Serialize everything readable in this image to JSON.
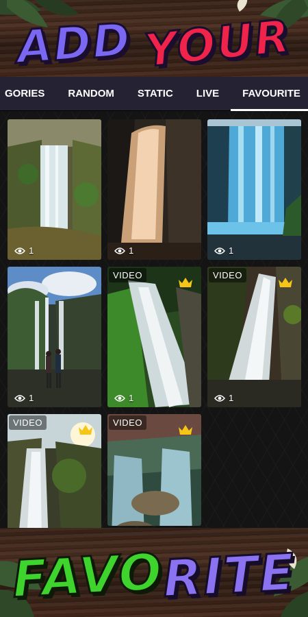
{
  "banner_top": {
    "word1": "ADD",
    "word2": "YOUR"
  },
  "banner_bottom": {
    "part_green": "FAVO",
    "part_purple": "RITE"
  },
  "tabs": [
    {
      "label": "GORIES",
      "active": false
    },
    {
      "label": "RANDOM",
      "active": false
    },
    {
      "label": "STATIC",
      "active": false
    },
    {
      "label": "LIVE",
      "active": false
    },
    {
      "label": "FAVOURITE",
      "active": true
    }
  ],
  "wallpapers": [
    {
      "type": "static",
      "views": "1",
      "premium": false
    },
    {
      "type": "static",
      "views": "1",
      "premium": false
    },
    {
      "type": "static",
      "views": "1",
      "premium": false
    },
    {
      "type": "static",
      "views": "1",
      "premium": false
    },
    {
      "badge": "VIDEO",
      "views": "1",
      "premium": true
    },
    {
      "badge": "VIDEO",
      "views": "1",
      "premium": true
    },
    {
      "badge": "VIDEO",
      "premium": true
    },
    {
      "badge": "VIDEO",
      "premium": true
    }
  ],
  "colors": {
    "tab_bar": "#252233",
    "accent_purple": "#7b68f2",
    "accent_red": "#f0244b",
    "accent_green": "#3fd32e",
    "crown": "#f5c518"
  }
}
